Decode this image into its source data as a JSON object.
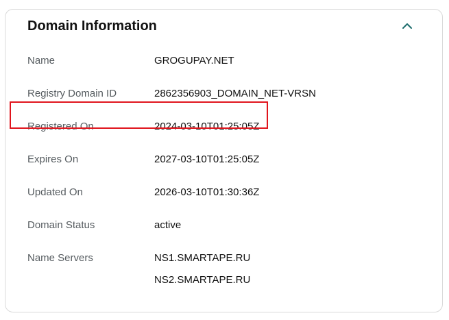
{
  "card": {
    "title": "Domain Information",
    "collapse_icon": "chevron-up-icon",
    "accent_color": "#1b6b6b",
    "highlight_color": "#e0141c"
  },
  "fields": {
    "name": {
      "label": "Name",
      "value": "GROGUPAY.NET"
    },
    "registry_id": {
      "label": "Registry Domain ID",
      "value": "2862356903_DOMAIN_NET-VRSN"
    },
    "registered_on": {
      "label": "Registered On",
      "value": "2024-03-10T01:25:05Z"
    },
    "expires_on": {
      "label": "Expires On",
      "value": "2027-03-10T01:25:05Z"
    },
    "updated_on": {
      "label": "Updated On",
      "value": "2026-03-10T01:30:36Z"
    },
    "domain_status": {
      "label": "Domain Status",
      "value": "active"
    },
    "name_servers": {
      "label": "Name Servers",
      "values": [
        "NS1.SMARTAPE.RU",
        "NS2.SMARTAPE.RU"
      ]
    }
  }
}
